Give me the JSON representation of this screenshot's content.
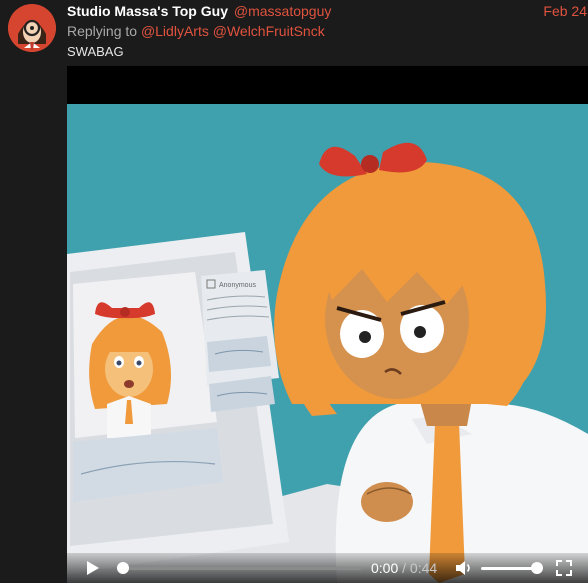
{
  "tweet": {
    "display_name": "Studio Massa's Top Guy",
    "handle": "@massatopguy",
    "date": "Feb 24",
    "replying_to_label": "Replying to",
    "replying_to": [
      "@LidlyArts",
      "@WelchFruitSnck"
    ],
    "text": "SWABAG"
  },
  "video": {
    "current_time": "0:00",
    "separator": "/",
    "duration": "0:44",
    "progress_fraction": 0.0,
    "volume_fraction": 0.9,
    "screen_label": "Anonymous"
  },
  "icons": {
    "avatar": "avatar-icon",
    "play": "play-icon",
    "volume": "volume-icon",
    "fullscreen": "fullscreen-icon"
  },
  "colors": {
    "background": "#1b1b1b",
    "accent": "#e0533f",
    "scene_teal": "#3fa0ae",
    "hair_orange": "#f09a3b"
  }
}
